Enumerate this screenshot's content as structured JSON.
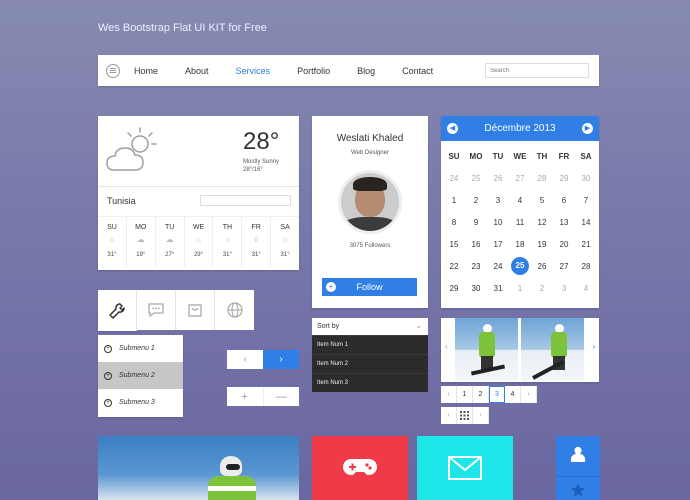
{
  "kit_title": "Wes Bootstrap Flat UI KIT for Free",
  "navbar": {
    "items": [
      "Home",
      "About",
      "Services",
      "Portfolio",
      "Blog",
      "Contact"
    ],
    "active": "Services",
    "search_placeholder": "Search"
  },
  "weather": {
    "temperature": "28°",
    "condition": "Mostly Sunny",
    "range": "28°/16°",
    "city": "Tunisia",
    "days": [
      {
        "day": "SU",
        "temp": "31°",
        "icon": "sun-icon"
      },
      {
        "day": "MO",
        "temp": "19°",
        "icon": "rain-cloud-icon"
      },
      {
        "day": "TU",
        "temp": "27°",
        "icon": "cloud-icon"
      },
      {
        "day": "WE",
        "temp": "29°",
        "icon": "sun-icon"
      },
      {
        "day": "TH",
        "temp": "31°",
        "icon": "sun-icon"
      },
      {
        "day": "FR",
        "temp": "31°",
        "icon": "drop-icon"
      },
      {
        "day": "SA",
        "temp": "31°",
        "icon": "sun-icon"
      }
    ]
  },
  "profile": {
    "name": "Weslati Khaled",
    "role": "Web Designer",
    "followers": "3075 Followers",
    "follow_label": "Follow"
  },
  "calendar": {
    "month": "Décembre 2013",
    "dow": [
      "SU",
      "MO",
      "TU",
      "WE",
      "TH",
      "FR",
      "SA"
    ],
    "rows": [
      [
        "24",
        "25",
        "26",
        "27",
        "28",
        "29",
        "30"
      ],
      [
        "1",
        "2",
        "3",
        "4",
        "5",
        "6",
        "7"
      ],
      [
        "8",
        "9",
        "10",
        "11",
        "12",
        "13",
        "14"
      ],
      [
        "15",
        "16",
        "17",
        "18",
        "19",
        "20",
        "21"
      ],
      [
        "22",
        "23",
        "24",
        "25",
        "26",
        "27",
        "28"
      ],
      [
        "29",
        "30",
        "31",
        "1",
        "2",
        "3",
        "4"
      ]
    ],
    "today": "25"
  },
  "tabs": [
    "wrench-icon",
    "chat-icon",
    "bag-icon",
    "globe-icon"
  ],
  "submenu": [
    "Submenu 1",
    "Submenu 2",
    "Submenu 3"
  ],
  "arrows": {
    "prev": "‹",
    "next": "›"
  },
  "steppers": {
    "plus": "+",
    "minus": "—"
  },
  "dropdown": {
    "label": "Sort by",
    "items": [
      "Item Num 1",
      "Item Num 2",
      "Item Num 3"
    ]
  },
  "pagination": {
    "pages": [
      "1",
      "2",
      "3",
      "4"
    ],
    "active": "3",
    "prev": "‹",
    "next": "›"
  },
  "mini_pager": {
    "prev": "‹",
    "next": "›"
  },
  "colors": {
    "accent": "#2f7fe6",
    "red_tile": "#f03a48",
    "cyan_tile": "#1ee6e8"
  }
}
